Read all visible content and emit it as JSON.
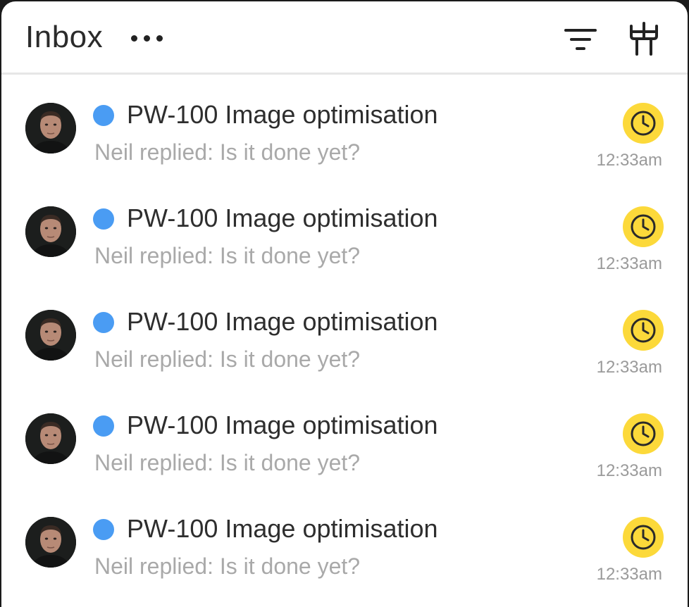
{
  "header": {
    "title": "Inbox",
    "more_icon": "more-horizontal-icon",
    "filter_icon": "filter-icon",
    "settings_icon": "settings-icon"
  },
  "colors": {
    "unread_dot": "#4a9cf3",
    "snooze_badge": "#fcd93a",
    "title_text": "#2e2e2e",
    "subtitle_text": "#a9a9a9"
  },
  "items": [
    {
      "title": "PW-100 Image optimisation",
      "subtitle": "Neil replied: Is it done yet?",
      "time": "12:33am",
      "status_icon": "clock-icon"
    },
    {
      "title": "PW-100 Image optimisation",
      "subtitle": "Neil replied: Is it done yet?",
      "time": "12:33am",
      "status_icon": "clock-icon"
    },
    {
      "title": "PW-100 Image optimisation",
      "subtitle": "Neil replied: Is it done yet?",
      "time": "12:33am",
      "status_icon": "clock-icon"
    },
    {
      "title": "PW-100 Image optimisation",
      "subtitle": "Neil replied: Is it done yet?",
      "time": "12:33am",
      "status_icon": "clock-icon"
    },
    {
      "title": "PW-100 Image optimisation",
      "subtitle": "Neil replied: Is it done yet?",
      "time": "12:33am",
      "status_icon": "clock-icon"
    }
  ]
}
